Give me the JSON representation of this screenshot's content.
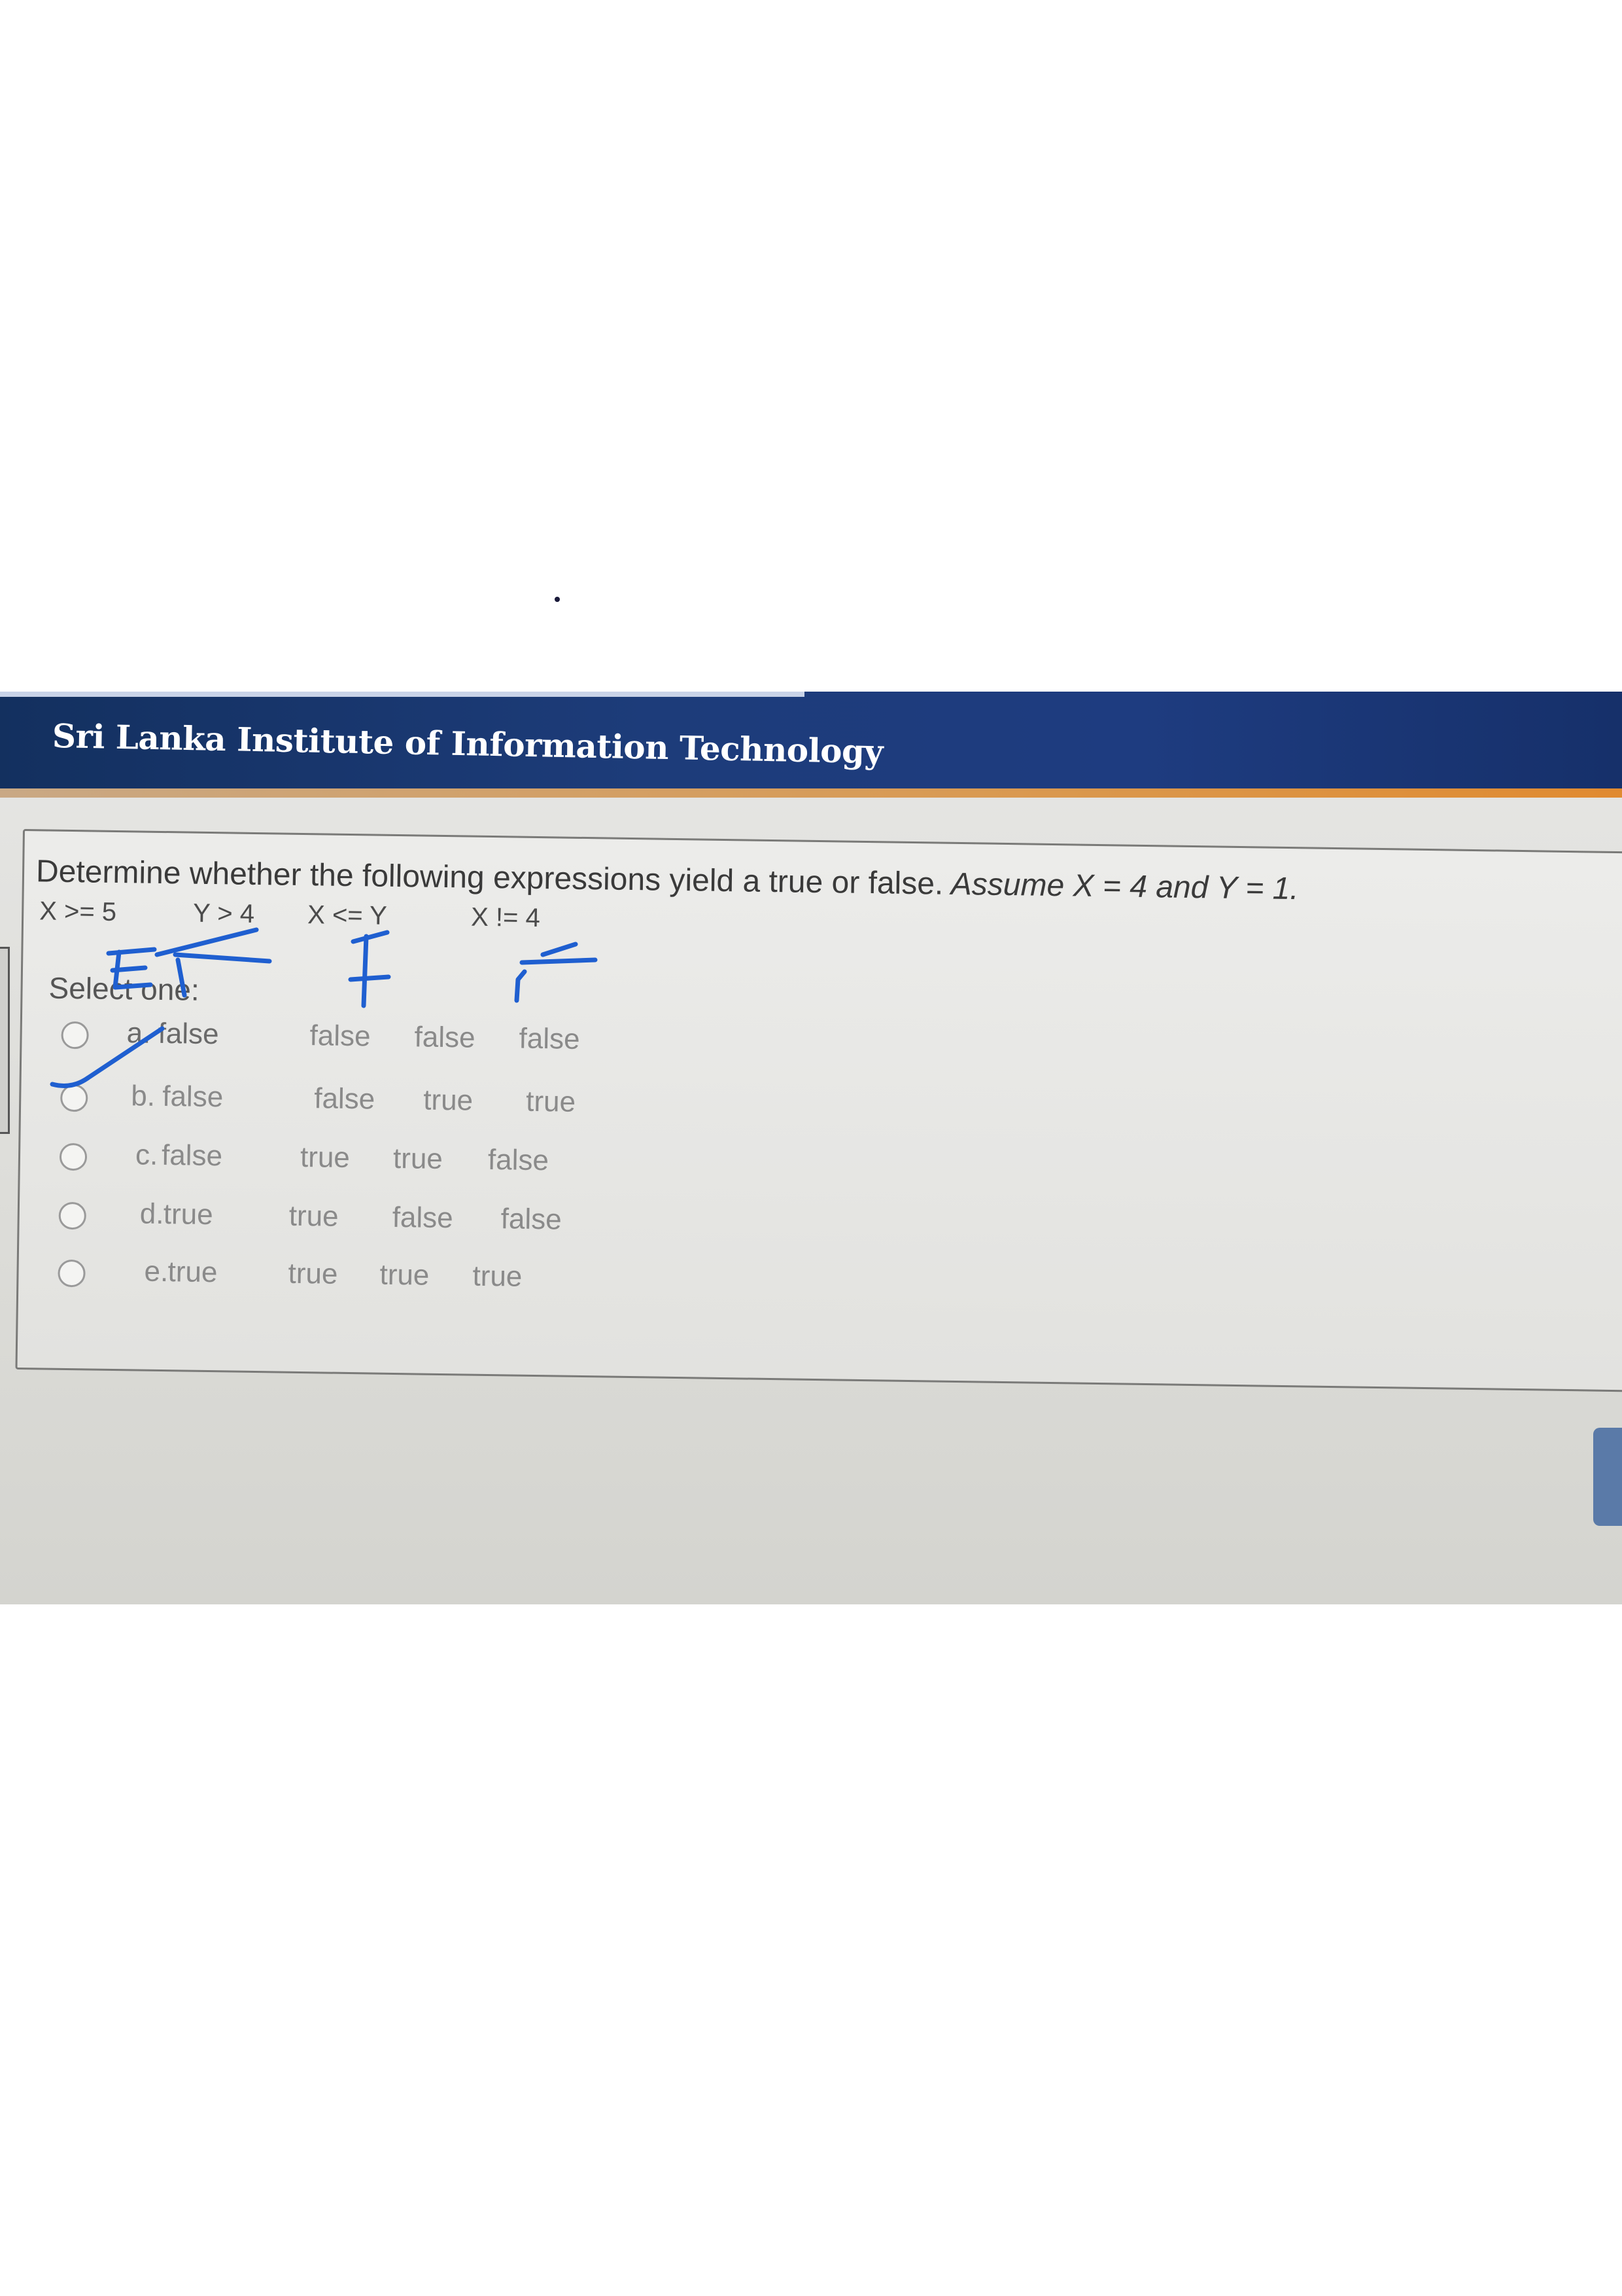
{
  "header": {
    "institute_name": "Sri Lanka Institute of Information Technology"
  },
  "question": {
    "text_main": "Determine whether the following expressions yield a true or false.",
    "text_assume": " Assume X = 4 and Y = 1.",
    "expressions": [
      "X >= 5",
      "Y > 4",
      "X <= Y",
      "X != 4"
    ],
    "select_label": "Select one:"
  },
  "options": [
    {
      "letter": "a.",
      "values": [
        "false",
        "false",
        "false",
        "false"
      ]
    },
    {
      "letter": "b.",
      "values": [
        "false",
        "false",
        "true",
        "true"
      ]
    },
    {
      "letter": "c.",
      "values": [
        "false",
        "true",
        "true",
        "false"
      ]
    },
    {
      "letter": "d.",
      "values": [
        "true",
        "true",
        "false",
        "false"
      ]
    },
    {
      "letter": "e.",
      "values": [
        "true",
        "true",
        "true",
        "true"
      ]
    }
  ],
  "colors": {
    "header_blue": "#1e3c80",
    "accent_orange": "#e08a30",
    "annotation_ink": "#1f5fd0"
  },
  "handwritten_marks": [
    "F",
    "F",
    "F",
    "F",
    "checkmark-on-option-a"
  ]
}
